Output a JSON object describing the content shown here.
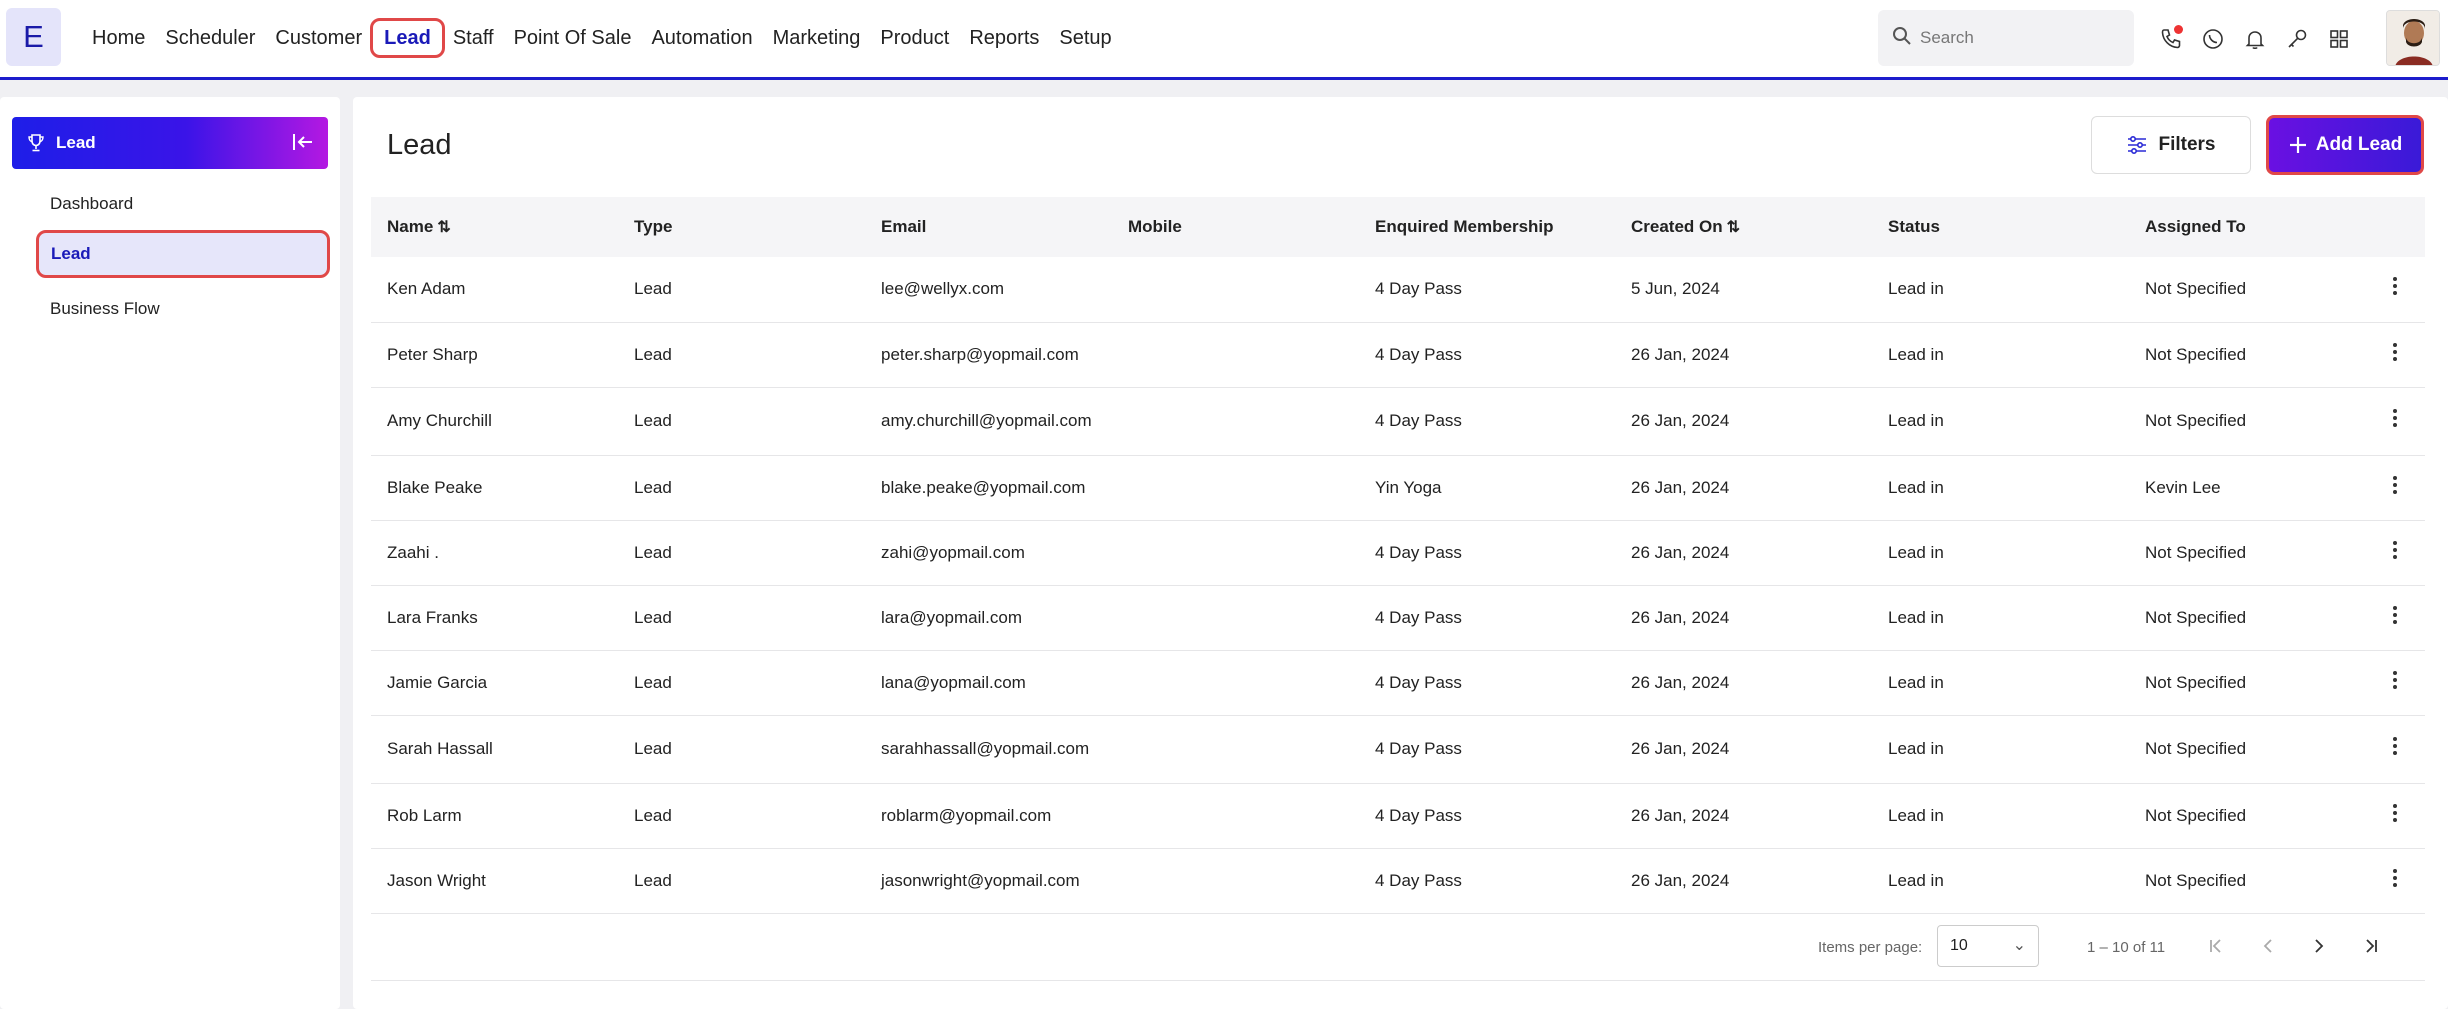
{
  "logo": "E",
  "nav": {
    "items": [
      "Home",
      "Scheduler",
      "Customer",
      "Lead",
      "Staff",
      "Point Of Sale",
      "Automation",
      "Marketing",
      "Product",
      "Reports",
      "Setup"
    ]
  },
  "search": {
    "placeholder": "Search"
  },
  "sidebar": {
    "header": "Lead",
    "items": [
      "Dashboard",
      "Lead",
      "Business Flow"
    ]
  },
  "main": {
    "title": "Lead",
    "filters_label": "Filters",
    "add_label": "Add Lead"
  },
  "table": {
    "headers": [
      "Name",
      "Type",
      "Email",
      "Mobile",
      "Enquired Membership",
      "Created On",
      "Status",
      "Assigned To"
    ],
    "rows": [
      {
        "name": "Ken Adam",
        "type": "Lead",
        "email": "lee@wellyx.com",
        "mobile": "",
        "membership": "4 Day Pass",
        "created": "5 Jun, 2024",
        "status": "Lead in",
        "assigned": "Not Specified"
      },
      {
        "name": "Peter Sharp",
        "type": "Lead",
        "email": "peter.sharp@yopmail.com",
        "mobile": "",
        "membership": "4 Day Pass",
        "created": "26 Jan, 2024",
        "status": "Lead in",
        "assigned": "Not Specified"
      },
      {
        "name": "Amy Churchill",
        "type": "Lead",
        "email": "amy.churchill@yopmail.com",
        "mobile": "",
        "membership": "4 Day Pass",
        "created": "26 Jan, 2024",
        "status": "Lead in",
        "assigned": "Not Specified"
      },
      {
        "name": "Blake Peake",
        "type": "Lead",
        "email": "blake.peake@yopmail.com",
        "mobile": "",
        "membership": "Yin Yoga",
        "created": "26 Jan, 2024",
        "status": "Lead in",
        "assigned": "Kevin Lee"
      },
      {
        "name": "Zaahi .",
        "type": "Lead",
        "email": "zahi@yopmail.com",
        "mobile": "",
        "membership": "4 Day Pass",
        "created": "26 Jan, 2024",
        "status": "Lead in",
        "assigned": "Not Specified"
      },
      {
        "name": "Lara Franks",
        "type": "Lead",
        "email": "lara@yopmail.com",
        "mobile": "",
        "membership": "4 Day Pass",
        "created": "26 Jan, 2024",
        "status": "Lead in",
        "assigned": "Not Specified"
      },
      {
        "name": "Jamie Garcia",
        "type": "Lead",
        "email": "lana@yopmail.com",
        "mobile": "",
        "membership": "4 Day Pass",
        "created": "26 Jan, 2024",
        "status": "Lead in",
        "assigned": "Not Specified"
      },
      {
        "name": "Sarah Hassall",
        "type": "Lead",
        "email": "sarahhassall@yopmail.com",
        "mobile": "",
        "membership": "4 Day Pass",
        "created": "26 Jan, 2024",
        "status": "Lead in",
        "assigned": "Not Specified"
      },
      {
        "name": "Rob Larm",
        "type": "Lead",
        "email": "roblarm@yopmail.com",
        "mobile": "",
        "membership": "4 Day Pass",
        "created": "26 Jan, 2024",
        "status": "Lead in",
        "assigned": "Not Specified"
      },
      {
        "name": "Jason Wright",
        "type": "Lead",
        "email": "jasonwright@yopmail.com",
        "mobile": "",
        "membership": "4 Day Pass",
        "created": "26 Jan, 2024",
        "status": "Lead in",
        "assigned": "Not Specified"
      }
    ]
  },
  "paginator": {
    "items_per_page_label": "Items per page:",
    "page_size": "10",
    "range": "1 – 10 of 11"
  },
  "colors": {
    "accent": "#1c1ccc",
    "highlight_border": "#e04848",
    "gradient_start": "#1e1ee8",
    "gradient_end": "#b418e2"
  },
  "icons": {
    "top": [
      "phone-icon",
      "whatsapp-icon",
      "bell-icon",
      "key-icon",
      "grid-icon"
    ],
    "sidebar": [
      "trophy-icon",
      "collapse-icon"
    ],
    "actions": [
      "filter-icon",
      "plus-icon",
      "kebab-icon"
    ],
    "pagination": [
      "first-page-icon",
      "prev-page-icon",
      "next-page-icon",
      "last-page-icon"
    ]
  }
}
